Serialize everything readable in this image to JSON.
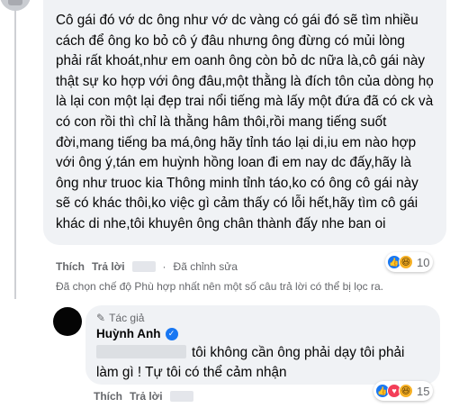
{
  "comment": {
    "text": "Cô gái đó vớ dc ông như vớ dc vàng có gái đó sẽ tìm nhiều cách để ông ko bỏ cô ý đâu nhưng ông đừng có mủi lòng phải rất khoát,như em oanh ông còn bỏ dc nữa là,cô gái này thật sự ko hợp với ông đâu,một thằng là đích tôn của dòng họ là lại con một lại đẹp trai nổi tiếng mà lấy một đứa đã có ck và có con rồi thì chỉ là thằng hâm thôi,rồi mang tiếng suốt đời,mang tiếng ba má,ông hãy tỉnh táo lại di,iu em nào hợp với ông ý,tán em huỳnh hồng loan đi em nay dc đấy,hãy là ông như truoc kia Thông minh tỉnh táo,ko có ông cô gái này sẽ có khác thôi,ko việc gì cảm thấy có lỗi hết,hãy tìm cô gái khác di nhe,tôi khuyên ông chân thành đấy nhe ban oi",
    "like_label": "Thích",
    "reply_label": "Trả lời",
    "edited_label": "Đã chỉnh sửa",
    "reaction_count": "10",
    "reactions": [
      "like-icon",
      "haha-icon"
    ]
  },
  "filter_notice": "Đã chọn chế độ Phù hợp nhất nên một số câu trả lời có thể bị lọc ra.",
  "reply": {
    "author_tag": "Tác giả",
    "author_name": "Huỳnh Anh",
    "text": "tôi không cần ông phải dạy tôi phải làm gì ! Tự tôi có thể cảm nhận",
    "like_label": "Thích",
    "reply_label": "Trả lời",
    "reaction_count": "15",
    "reactions": [
      "like-icon",
      "love-icon",
      "haha-icon"
    ]
  },
  "colors": {
    "bubble": "#f0f2f5",
    "meta": "#65676b",
    "like": "#1877f2",
    "love": "#f33e58",
    "haha": "#f7b125"
  }
}
